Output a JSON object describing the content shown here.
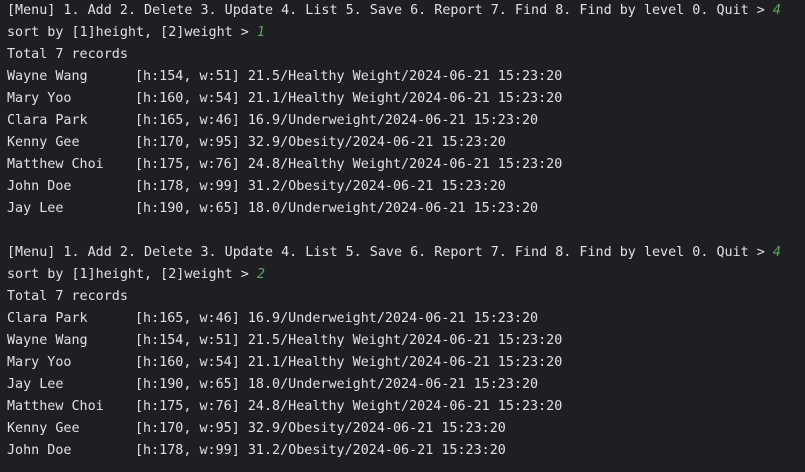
{
  "blocks": [
    {
      "menu_prompt": "[Menu] 1. Add 2. Delete 3. Update 4. List 5. Save 6. Report 7. Find 8. Find by level 0. Quit > ",
      "menu_input": "4",
      "sort_prompt": "sort by [1]height, [2]weight > ",
      "sort_input": "1",
      "total": "Total 7 records",
      "records": [
        {
          "name": "Wayne Wang",
          "detail": "[h:154, w:51] 21.5/Healthy Weight/2024-06-21 15:23:20"
        },
        {
          "name": "Mary Yoo",
          "detail": "[h:160, w:54] 21.1/Healthy Weight/2024-06-21 15:23:20"
        },
        {
          "name": "Clara Park",
          "detail": "[h:165, w:46] 16.9/Underweight/2024-06-21 15:23:20"
        },
        {
          "name": "Kenny Gee",
          "detail": "[h:170, w:95] 32.9/Obesity/2024-06-21 15:23:20"
        },
        {
          "name": "Matthew Choi",
          "detail": "[h:175, w:76] 24.8/Healthy Weight/2024-06-21 15:23:20"
        },
        {
          "name": "John Doe",
          "detail": "[h:178, w:99] 31.2/Obesity/2024-06-21 15:23:20"
        },
        {
          "name": "Jay Lee",
          "detail": "[h:190, w:65] 18.0/Underweight/2024-06-21 15:23:20"
        }
      ]
    },
    {
      "menu_prompt": "[Menu] 1. Add 2. Delete 3. Update 4. List 5. Save 6. Report 7. Find 8. Find by level 0. Quit > ",
      "menu_input": "4",
      "sort_prompt": "sort by [1]height, [2]weight > ",
      "sort_input": "2",
      "total": "Total 7 records",
      "records": [
        {
          "name": "Clara Park",
          "detail": "[h:165, w:46] 16.9/Underweight/2024-06-21 15:23:20"
        },
        {
          "name": "Wayne Wang",
          "detail": "[h:154, w:51] 21.5/Healthy Weight/2024-06-21 15:23:20"
        },
        {
          "name": "Mary Yoo",
          "detail": "[h:160, w:54] 21.1/Healthy Weight/2024-06-21 15:23:20"
        },
        {
          "name": "Jay Lee",
          "detail": "[h:190, w:65] 18.0/Underweight/2024-06-21 15:23:20"
        },
        {
          "name": "Matthew Choi",
          "detail": "[h:175, w:76] 24.8/Healthy Weight/2024-06-21 15:23:20"
        },
        {
          "name": "Kenny Gee",
          "detail": "[h:170, w:95] 32.9/Obesity/2024-06-21 15:23:20"
        },
        {
          "name": "John Doe",
          "detail": "[h:178, w:99] 31.2/Obesity/2024-06-21 15:23:20"
        }
      ]
    }
  ],
  "colors": {
    "background": "#1e1f22",
    "text": "#dfe1e5",
    "user_input": "#5fa35f"
  }
}
